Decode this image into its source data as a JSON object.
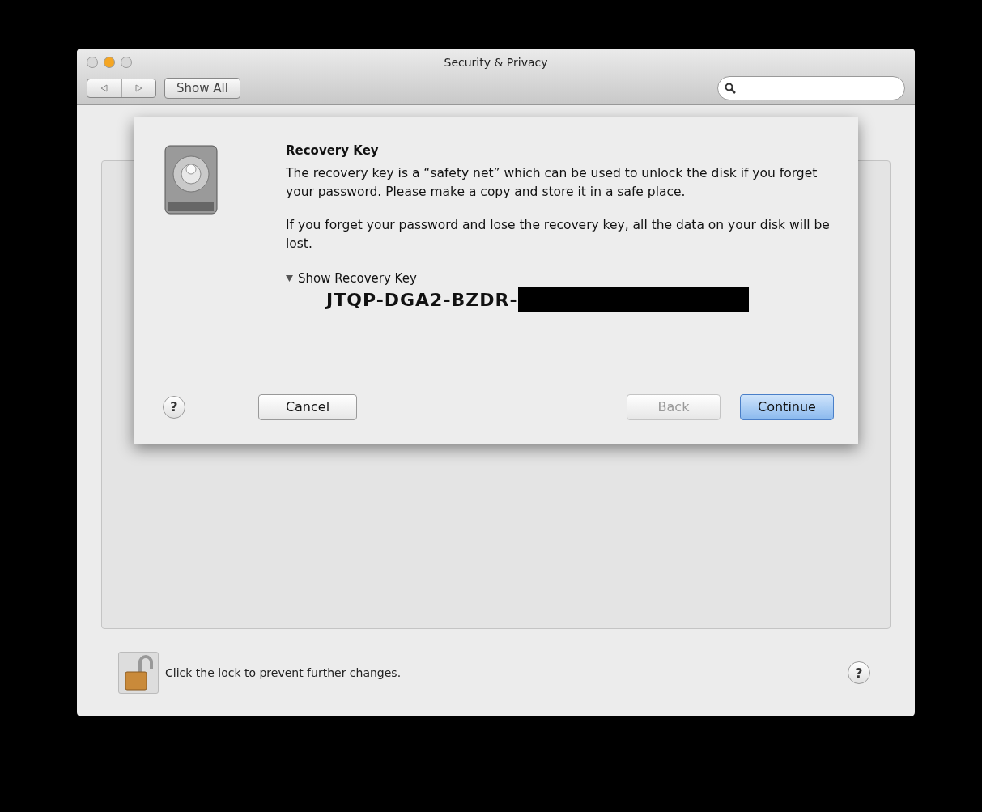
{
  "window": {
    "title": "Security & Privacy"
  },
  "toolbar": {
    "show_all": "Show All"
  },
  "sheet": {
    "title": "Recovery Key",
    "paragraphs": [
      "The recovery key is a “safety net” which can be used to unlock the disk if you forget your password. Please make a copy and store it in a safe place.",
      "If you forget your password and lose the recovery key, all the data on your disk will be lost."
    ],
    "disclosure": {
      "label": "Show Recovery Key",
      "expanded": true
    },
    "recovery_key": {
      "text": "JTQP-DGA2-BZDR-",
      "redacted": true
    },
    "help": "?",
    "buttons": [
      {
        "label": "Cancel",
        "disabled": false,
        "default": false,
        "kind": "cancel"
      },
      {
        "label": "Back",
        "disabled": true,
        "default": false,
        "kind": "step"
      },
      {
        "label": "Continue",
        "disabled": false,
        "default": true,
        "kind": "step"
      }
    ]
  },
  "footer": {
    "lock_text": "Click the lock to prevent further changes.",
    "locked": false,
    "help": "?"
  }
}
